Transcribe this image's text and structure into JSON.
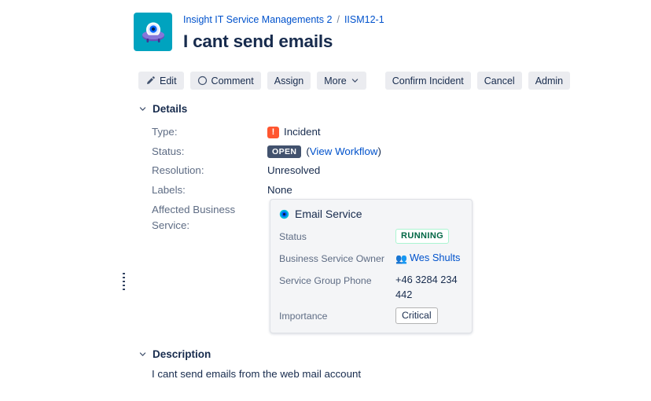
{
  "header": {
    "avatar_icon": "insight-ufo-logo",
    "breadcrumb": {
      "project": "Insight IT Service Managements 2",
      "separator": "/",
      "issue_key": "IISM12-1"
    },
    "title": "I cant send emails"
  },
  "toolbar": {
    "edit_label": "Edit",
    "edit_icon": "pencil-icon",
    "comment_label": "Comment",
    "comment_icon": "comment-bubble-icon",
    "assign_label": "Assign",
    "more_label": "More",
    "more_icon": "chevron-down-icon",
    "confirm_incident_label": "Confirm Incident",
    "cancel_label": "Cancel",
    "admin_label": "Admin"
  },
  "details": {
    "section_title": "Details",
    "collapse_icon": "chevron-down-icon",
    "rows": [
      {
        "label": "Type:",
        "value": "Incident",
        "icon": "incident-priority-icon"
      },
      {
        "label": "Status:",
        "value": "OPEN",
        "link": "View Workflow",
        "paren_open": "(",
        "paren_close": ")"
      },
      {
        "label": "Resolution:",
        "value": "Unresolved"
      },
      {
        "label": "Labels:",
        "value": "None"
      }
    ],
    "affected_label": "Affected Business Service:"
  },
  "object_card": {
    "icon": "insight-object-icon",
    "title": "Email Service",
    "attributes": [
      {
        "key": "Status",
        "value": "RUNNING",
        "type": "badge"
      },
      {
        "key": "Business Service Owner",
        "value": "Wes Shults",
        "type": "link",
        "icon": "people-icon"
      },
      {
        "key": "Service Group Phone",
        "value": "+46 3284 234 442",
        "type": "text"
      },
      {
        "key": "Importance",
        "value": "Critical",
        "type": "box"
      }
    ]
  },
  "description": {
    "section_title": "Description",
    "collapse_icon": "chevron-down-icon",
    "body": "I cant send emails from the web mail account"
  },
  "colors": {
    "link": "#0052CC",
    "text": "#172B4D",
    "subtle_text": "#5E6C84",
    "button_bg": "#EBECF0",
    "avatar_bg": "#00A3BF",
    "status_open_bg": "#42526E",
    "incident_red": "#FF5630",
    "running_green": "#006644",
    "card_bg": "#F4F5F7"
  }
}
